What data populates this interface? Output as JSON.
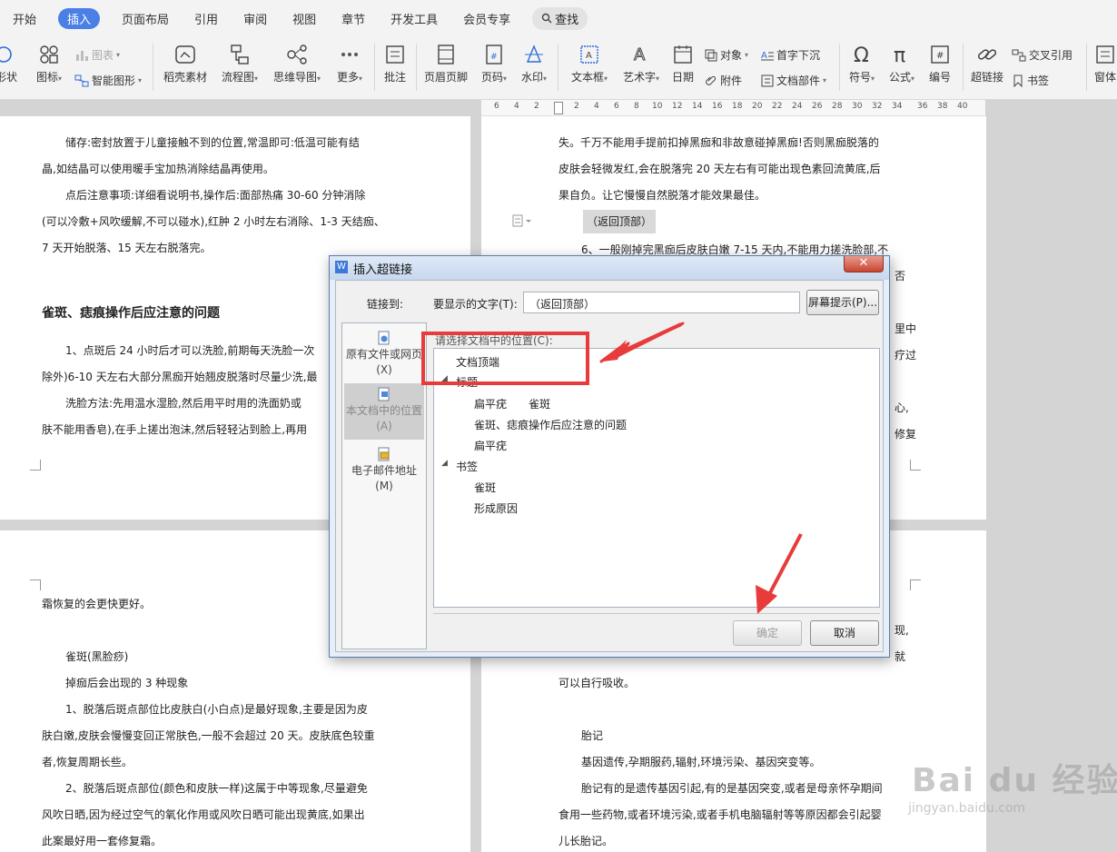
{
  "menubar": {
    "items": [
      "开始",
      "插入",
      "页面布局",
      "引用",
      "审阅",
      "视图",
      "章节",
      "开发工具",
      "会员专享"
    ],
    "active_index": 1,
    "search_label": "查找"
  },
  "ribbon": {
    "shape": "形状",
    "icon": "图标",
    "chart": "图表",
    "smart_graphic": "智能图形",
    "daoke_material": "稻壳素材",
    "flowchart": "流程图",
    "mindmap": "思维导图",
    "more": "更多",
    "comment": "批注",
    "header_footer": "页眉页脚",
    "page_number": "页码",
    "watermark": "水印",
    "textbox": "文本框",
    "wordart": "艺术字",
    "date": "日期",
    "object": "对象",
    "attachment": "附件",
    "drop_cap": "首字下沉",
    "doc_parts": "文档部件",
    "symbol": "符号",
    "formula": "公式",
    "numbering": "编号",
    "hyperlink": "超链接",
    "cross_reference": "交叉引用",
    "bookmark": "书签",
    "window": "窗体"
  },
  "ruler": [
    "6",
    "4",
    "2",
    "",
    "2",
    "4",
    "6",
    "8",
    "10",
    "12",
    "14",
    "16",
    "18",
    "20",
    "22",
    "24",
    "26",
    "28",
    "30",
    "32",
    "34",
    "36",
    "38",
    "40"
  ],
  "left_page_top": {
    "lines": [
      "储存:密封放置于儿童接触不到的位置,常温即可:低温可能有结",
      "晶,如结晶可以使用暖手宝加热消除结晶再使用。",
      "点后注意事项:详细看说明书,操作后:面部热痛 30-60 分钟消除",
      "(可以冷敷+风吹缓解,不可以碰水),红肿 2 小时左右消除、1-3 天结痂、",
      "7 天开始脱落、15 天左右脱落完。"
    ],
    "heading": "雀斑、痣痕操作后应注意的问题",
    "lines2": [
      "1、点斑后 24 小时后才可以洗脸,前期每天洗脸一次",
      "除外)6-10 天左右大部分黑痂开始翘皮脱落时尽量少洗,最",
      "洗脸方法:先用温水湿脸,然后用平时用的洗面奶或",
      "肤不能用香皂),在手上搓出泡沫,然后轻轻沾到脸上,再用"
    ]
  },
  "right_page_top": {
    "lines": [
      "失。千万不能用手提前扣掉黑痂和非故意碰掉黑痂!否则黑痂脱落的",
      "皮肤会轻微发红,会在脱落完 20 天左右有可能出现色素回流黄底,后",
      "果自负。让它慢慢自然脱落才能效果最佳。"
    ],
    "return_top": "（返回顶部）",
    "line_partial": "6、一般刚掉完黑痂后皮肤白嫩 7-15 天内,不能用力搓洗脸部,不",
    "right_fragments": [
      "否",
      "里中",
      "疗过",
      "心,",
      "修复"
    ]
  },
  "left_page_bottom": {
    "lines": [
      "霜恢复的会更快更好。",
      "雀斑(黑脸痧)",
      "掉痂后会出现的 3 种现象",
      "1、脱落后斑点部位比皮肤白(小白点)是最好现象,主要是因为皮",
      "肤白嫩,皮肤会慢慢变回正常肤色,一般不会超过 20 天。皮肤底色较重",
      "者,恢复周期长些。",
      "2、脱落后斑点部位(颜色和皮肤一样)这属于中等现象,尽量避免",
      "风吹日晒,因为经过空气的氧化作用或风吹日晒可能出现黄底,如果出",
      "此案最好用一套修复霜。"
    ]
  },
  "right_page_bottom": {
    "lines": [
      "可以自行吸收。",
      "胎记",
      "基因遗传,孕期服药,辐射,环境污染、基因突变等。",
      "胎记有的是遗传基因引起,有的是基因突变,或者是母亲怀孕期间",
      "食用一些药物,或者环境污染,或者手机电脑辐射等等原因都会引起婴",
      "儿长胎记。"
    ],
    "fragments": [
      "现,",
      "就"
    ]
  },
  "dialog": {
    "title": "插入超链接",
    "close_symbol": "✕",
    "link_to_label": "链接到:",
    "display_text_label": "要显示的文字(T):",
    "display_text_value": "（返回顶部）",
    "screen_tip_button": "屏幕提示(P)...",
    "linkto_items": [
      {
        "label": "原有文件或网页(X)"
      },
      {
        "label": "本文档中的位置(A)"
      },
      {
        "label": "电子邮件地址(M)"
      }
    ],
    "tree_header": "请选择文档中的位置(C):",
    "tree": {
      "top": "文档顶端",
      "headings_group": "标题",
      "headings": [
        "扁平疣　　雀斑",
        "雀斑、痣痕操作后应注意的问题",
        "扁平疣"
      ],
      "bookmarks_group": "书签",
      "bookmarks": [
        "雀斑",
        "形成原因"
      ]
    },
    "ok_button": "确定",
    "cancel_button": "取消"
  },
  "watermark": {
    "brand": "Bai du 经验",
    "url": "jingyan.baidu.com"
  },
  "colors": {
    "accent": "#4a7fe6",
    "annotation_red": "#e83b3b",
    "dialog_title": "#c7d7ee"
  }
}
